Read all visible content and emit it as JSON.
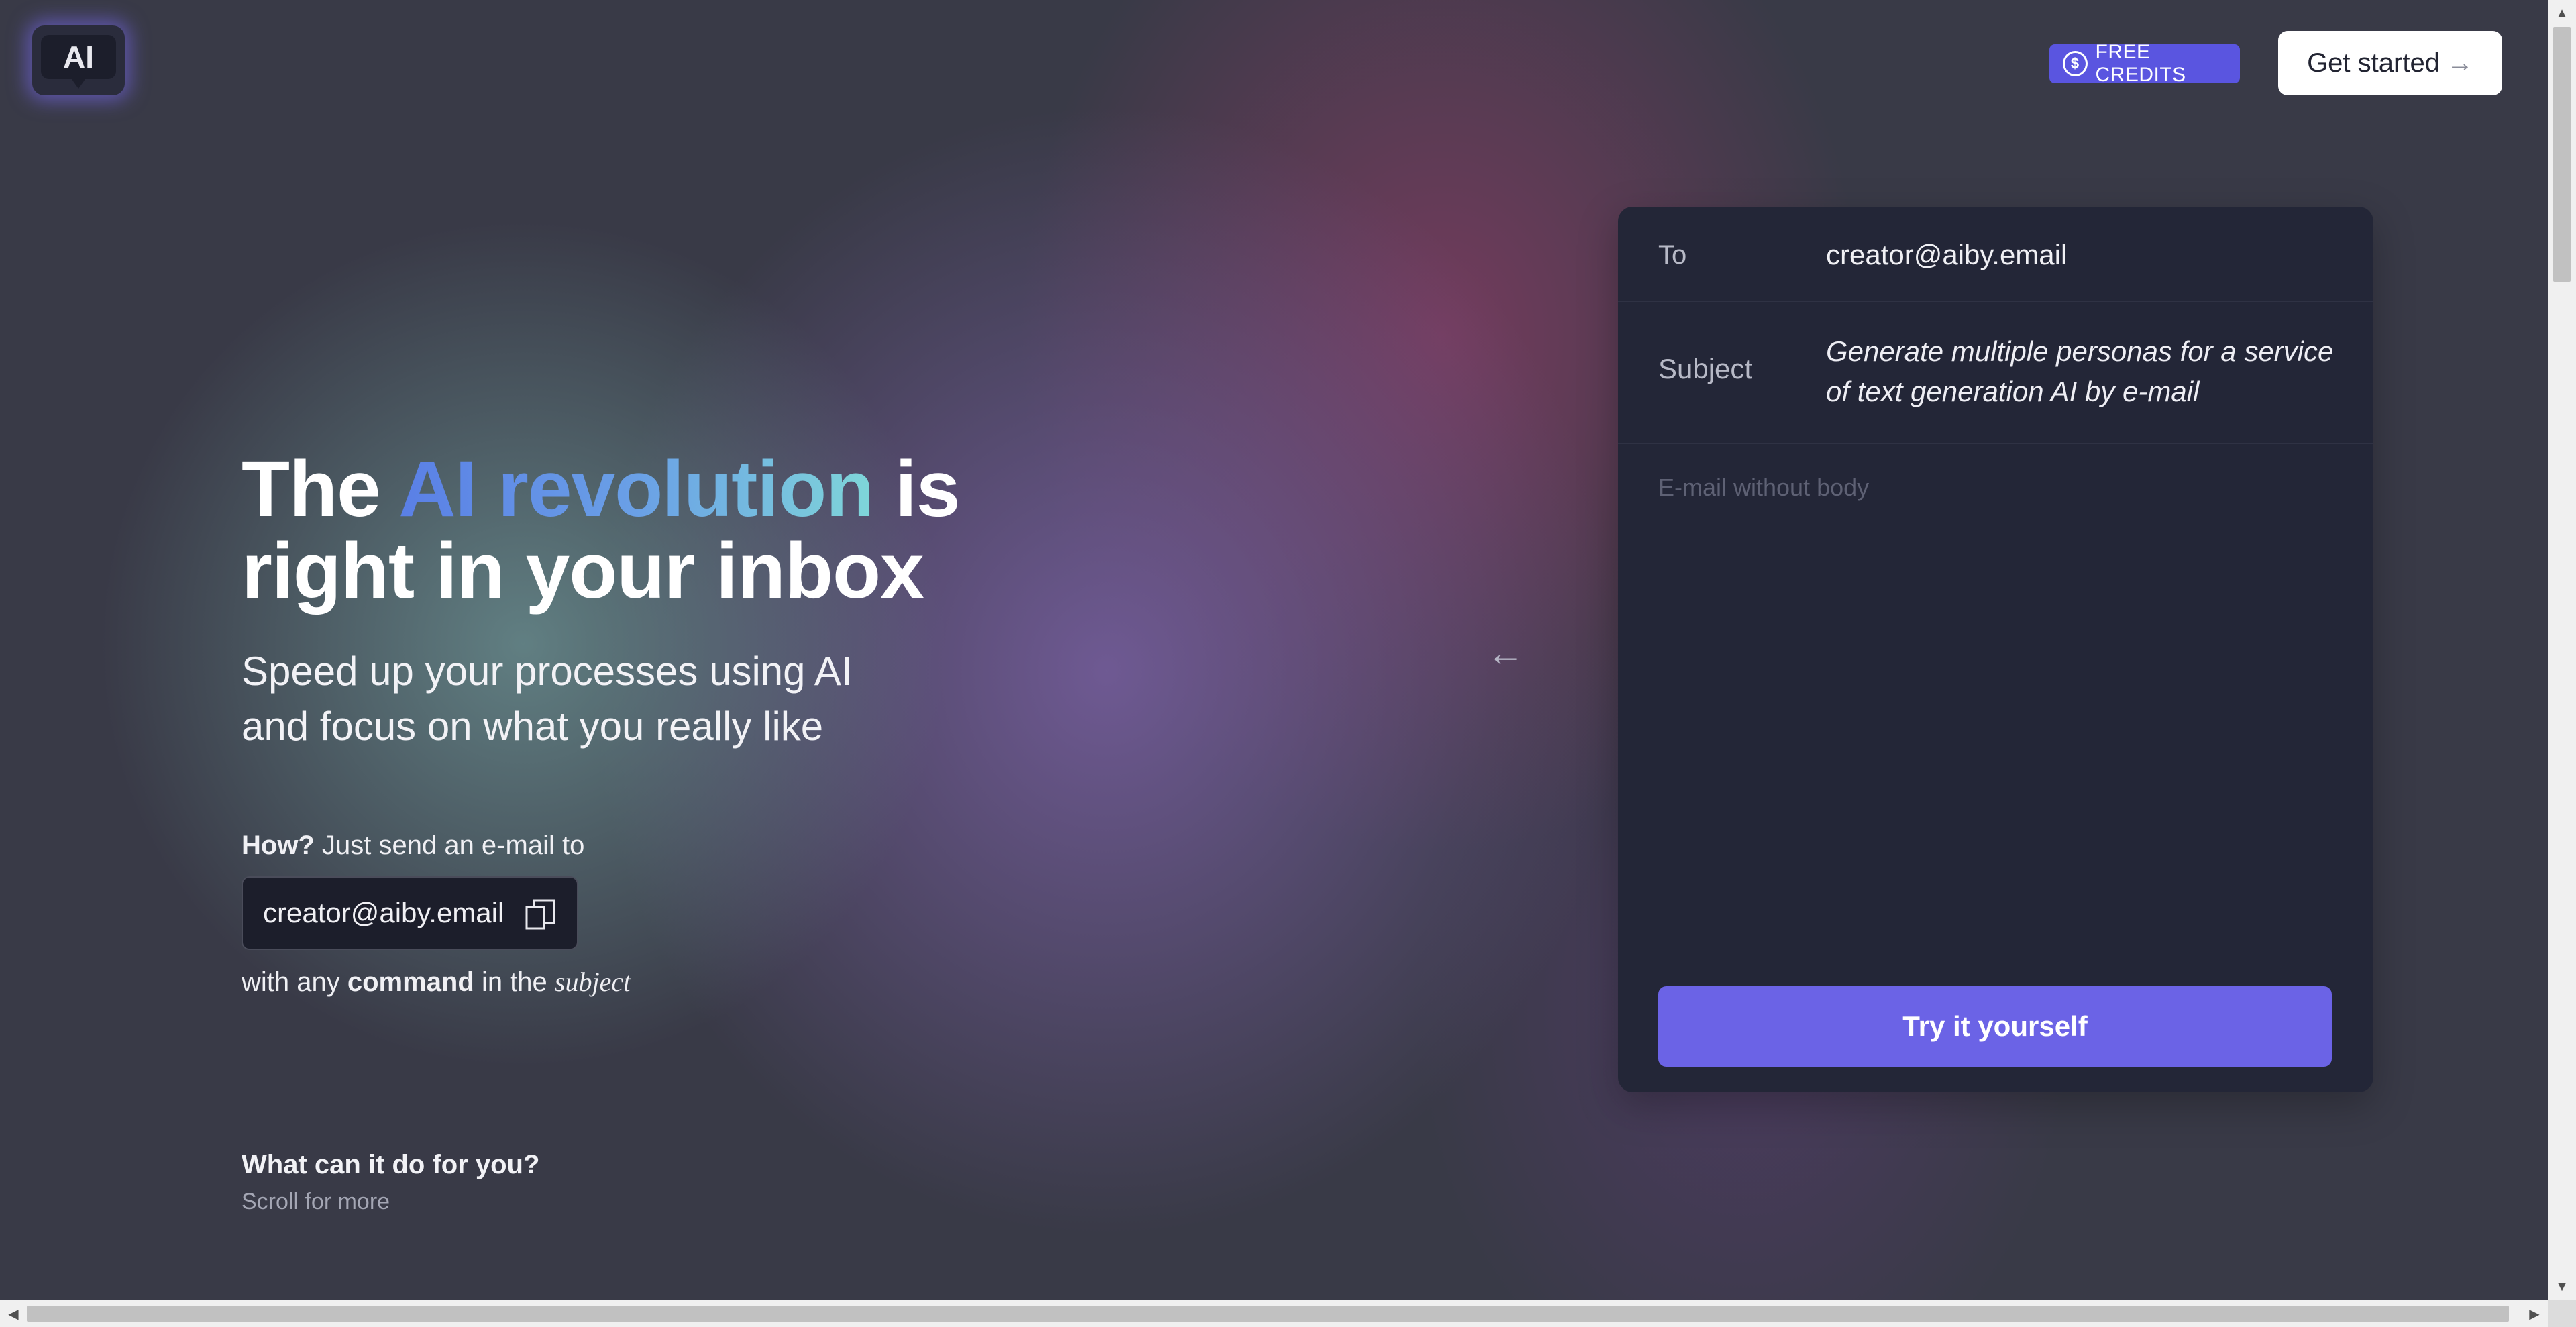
{
  "header": {
    "logo_text": "AI",
    "free_credits_label": "FREE CREDITS",
    "free_credits_icon": "coin-icon",
    "get_started_label": "Get started",
    "get_started_arrow": "→"
  },
  "hero": {
    "headline_the": "The",
    "headline_highlight": "AI revolution",
    "headline_is": "is",
    "headline_line2": "right in your inbox",
    "subline_1": "Speed up your processes using AI",
    "subline_2": "and focus on what you really like",
    "how_bold": "How?",
    "how_text": "Just send an e-mail to",
    "email_address": "creator@aiby.email",
    "with_any": "with any",
    "command": "command",
    "in_the": "in the",
    "subject": "subject",
    "what_can": "What can it do for you?",
    "scroll_more": "Scroll for more",
    "arrow": "←"
  },
  "email_card": {
    "to_label": "To",
    "to_value": "creator@aiby.email",
    "subject_label": "Subject",
    "subject_value": "Generate multiple personas for a service of text generation AI by e-mail",
    "body_placeholder": "E-mail without body",
    "try_button": "Try it yourself"
  },
  "colors": {
    "accent": "#6b63e6",
    "badge": "#5a55e0",
    "card_bg": "#232637",
    "highlight_gradient_start": "#5a7fe6",
    "highlight_gradient_end": "#7fd6d9"
  }
}
